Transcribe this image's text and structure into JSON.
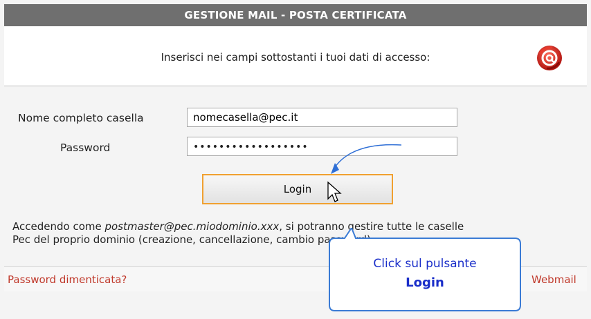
{
  "header": {
    "title": "GESTIONE MAIL - POSTA CERTIFICATA"
  },
  "intro": {
    "text": "Inserisci nei campi sottostanti i tuoi dati di accesso:"
  },
  "form": {
    "username_label": "Nome completo casella",
    "username_value": "nomecasella@pec.it",
    "password_label": "Password",
    "password_value": "••••••••••••••••••",
    "login_label": "Login"
  },
  "info": {
    "prefix": "Accedendo come ",
    "account": "postmaster@pec.miodominio.xxx",
    "line1_rest": ", si potranno gestire tutte le caselle",
    "line2": "Pec del proprio dominio (creazione, cancellazione, cambio password)"
  },
  "footer": {
    "forgot_link": "Password dimenticata?",
    "webmail_link": "Webmail"
  },
  "callout": {
    "line1": "Click sul pulsante",
    "line2": "Login"
  },
  "icons": {
    "logo": "at-sign-rose-icon",
    "cursor": "mouse-pointer-icon",
    "arrow": "curved-arrow-icon"
  },
  "colors": {
    "header_bg": "#6f6f6f",
    "button_border": "#f0a030",
    "link": "#c0392b",
    "callout_text": "#1a2ec9",
    "callout_border": "#3a7bd5"
  }
}
